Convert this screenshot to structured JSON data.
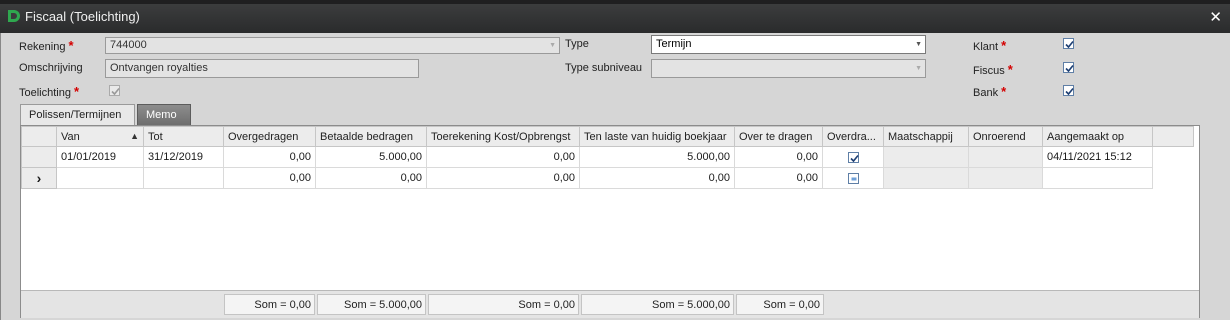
{
  "window": {
    "title": "Fiscaal (Toelichting)",
    "close_glyph": "✕"
  },
  "form": {
    "rekening": {
      "label": "Rekening",
      "value": "744000"
    },
    "omschrijving": {
      "label": "Omschrijving",
      "value": "Ontvangen royalties"
    },
    "toelichting": {
      "label": "Toelichting",
      "checked": true
    },
    "type": {
      "label": "Type",
      "value": "Termijn"
    },
    "type_subniveau": {
      "label": "Type subniveau",
      "value": ""
    },
    "klant": {
      "label": "Klant",
      "checked": true
    },
    "fiscus": {
      "label": "Fiscus",
      "checked": true
    },
    "bank": {
      "label": "Bank",
      "checked": true
    },
    "required_marker": "*"
  },
  "tabs": [
    {
      "label": "Polissen/Termijnen",
      "active": true
    },
    {
      "label": "Memo",
      "active": false
    }
  ],
  "grid": {
    "columns": [
      "Van",
      "Tot",
      "Overgedragen",
      "Betaalde bedragen",
      "Toerekening Kost/Opbrengst",
      "Ten laste van huidig boekjaar",
      "Over te dragen",
      "Overdra...",
      "Maatschappij",
      "Onroerend",
      "Aangemaakt op"
    ],
    "rows": [
      {
        "indicator": "",
        "van": "01/01/2019",
        "tot": "31/12/2019",
        "overgedragen": "0,00",
        "betaalde": "5.000,00",
        "toerekening": "0,00",
        "ten_laste": "5.000,00",
        "over_te_dragen": "0,00",
        "overdra": "checked",
        "maatschappij": "",
        "onroerend": "",
        "aangemaakt": "04/11/2021 15:12"
      },
      {
        "indicator": "›",
        "van": "",
        "tot": "",
        "overgedragen": "0,00",
        "betaalde": "0,00",
        "toerekening": "0,00",
        "ten_laste": "0,00",
        "over_te_dragen": "0,00",
        "overdra": "indeterminate",
        "maatschappij": "",
        "onroerend": "",
        "aangemaakt": ""
      }
    ],
    "footer": {
      "overgedragen": "Som = 0,00",
      "betaalde": "Som = 5.000,00",
      "toerekening": "Som = 0,00",
      "ten_laste": "Som = 5.000,00",
      "over_te_dragen": "Som = 0,00"
    }
  }
}
